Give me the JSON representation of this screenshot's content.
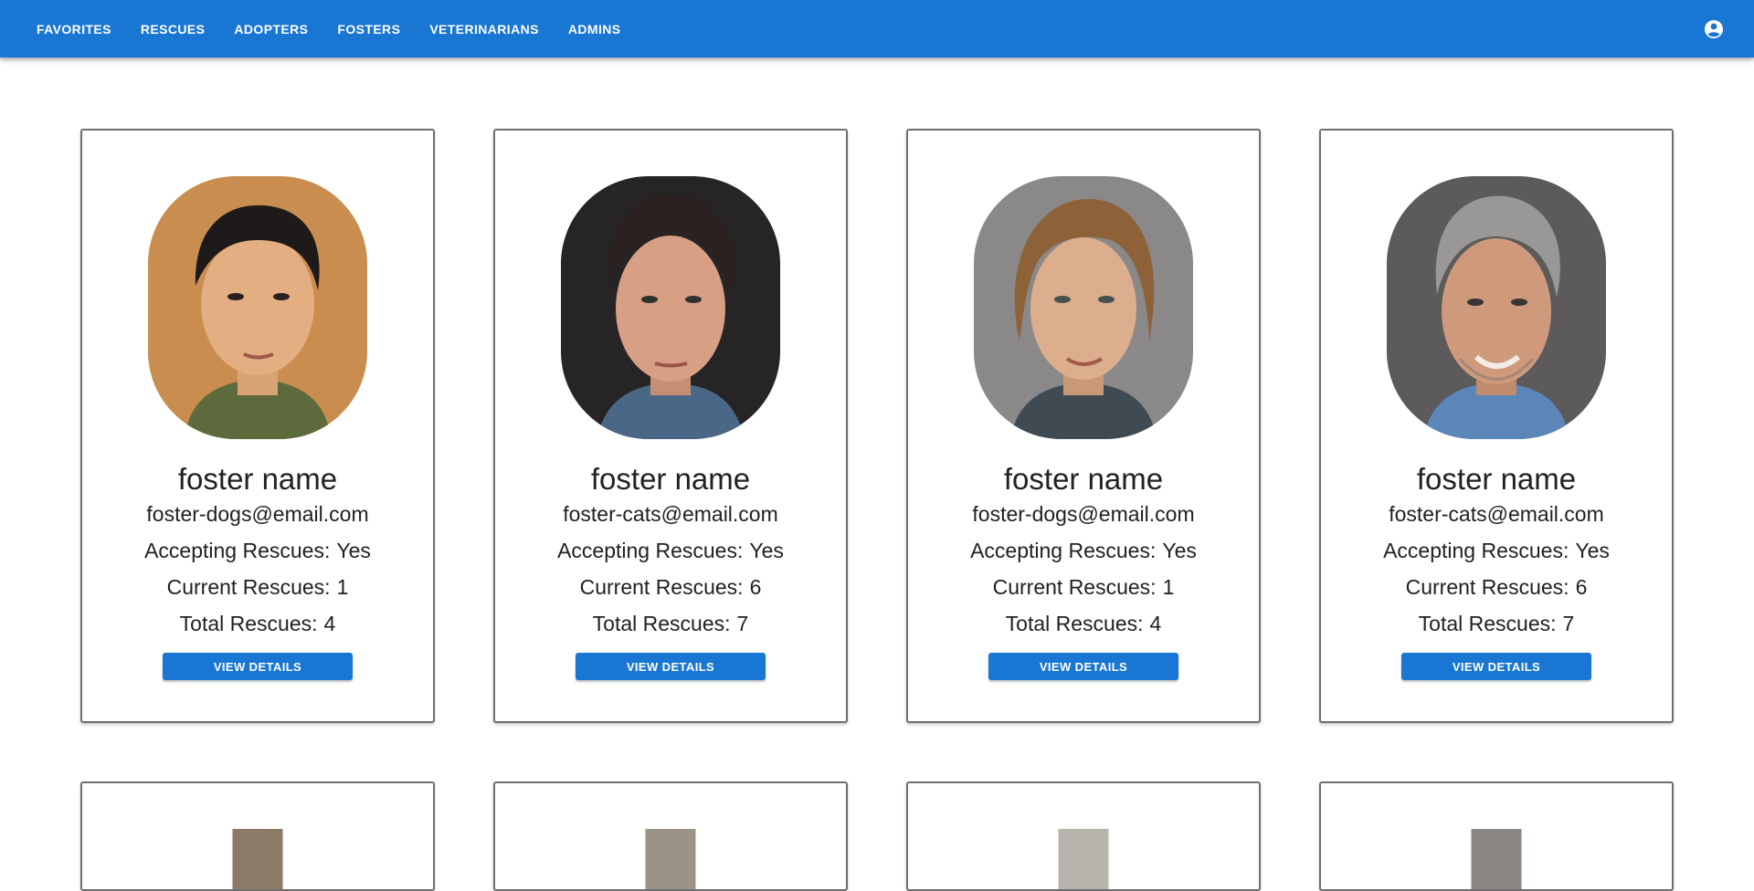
{
  "nav": {
    "items": [
      "FAVORITES",
      "RESCUES",
      "ADOPTERS",
      "FOSTERS",
      "VETERINARIANS",
      "ADMINS"
    ],
    "account_icon": "account-circle-icon"
  },
  "colors": {
    "primary": "#1976d2",
    "card_border": "#6f6f6f"
  },
  "labels": {
    "accepting": "Accepting Rescues:",
    "current": "Current Rescues:",
    "total": "Total Rescues:",
    "button": "VIEW DETAILS"
  },
  "fosters": [
    {
      "name": "foster name",
      "email": "foster-dogs@email.com",
      "accepting": "Yes",
      "current": "1",
      "total": "4"
    },
    {
      "name": "foster name",
      "email": "foster-cats@email.com",
      "accepting": "Yes",
      "current": "6",
      "total": "7"
    },
    {
      "name": "foster name",
      "email": "foster-dogs@email.com",
      "accepting": "Yes",
      "current": "1",
      "total": "4"
    },
    {
      "name": "foster name",
      "email": "foster-cats@email.com",
      "accepting": "Yes",
      "current": "6",
      "total": "7"
    }
  ]
}
